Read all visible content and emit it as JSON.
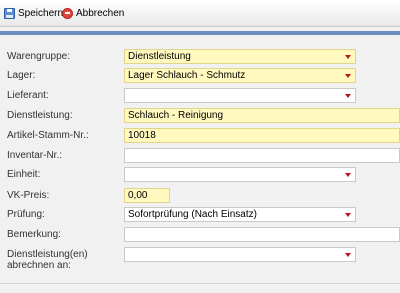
{
  "toolbar": {
    "save_label": "Speichern",
    "cancel_label": "Abbrechen"
  },
  "form": {
    "warengruppe": {
      "label": "Warengruppe:",
      "value": "Dienstleistung"
    },
    "lager": {
      "label": "Lager:",
      "value": "Lager Schlauch - Schmutz"
    },
    "lieferant": {
      "label": "Lieferant:",
      "value": ""
    },
    "dienstleistung": {
      "label": "Dienstleistung:",
      "value": "Schlauch - Reinigung"
    },
    "artikel": {
      "label": "Artikel-Stamm-Nr.:",
      "value": "10018"
    },
    "inventar": {
      "label": "Inventar-Nr.:",
      "value": ""
    },
    "einheit": {
      "label": "Einheit:",
      "value": ""
    },
    "vkpreis": {
      "label": "VK-Preis:",
      "value": "0,00"
    },
    "pruefung": {
      "label": "Prüfung:",
      "value": "Sofortprüfung (Nach Einsatz)"
    },
    "bemerkung": {
      "label": "Bemerkung:",
      "value": ""
    },
    "abrechnen": {
      "label_line1": "Dienstleistung(en)",
      "label_line2": "abrechnen an:",
      "value": ""
    }
  },
  "colors": {
    "required_bg": "#fff9bf",
    "caret": "#b41a1a",
    "header_bar": "#6b8ec0"
  },
  "icons": {
    "save": "floppy-disk-icon",
    "cancel": "cancel-circle-icon",
    "dropdown": "chevron-down-icon"
  }
}
